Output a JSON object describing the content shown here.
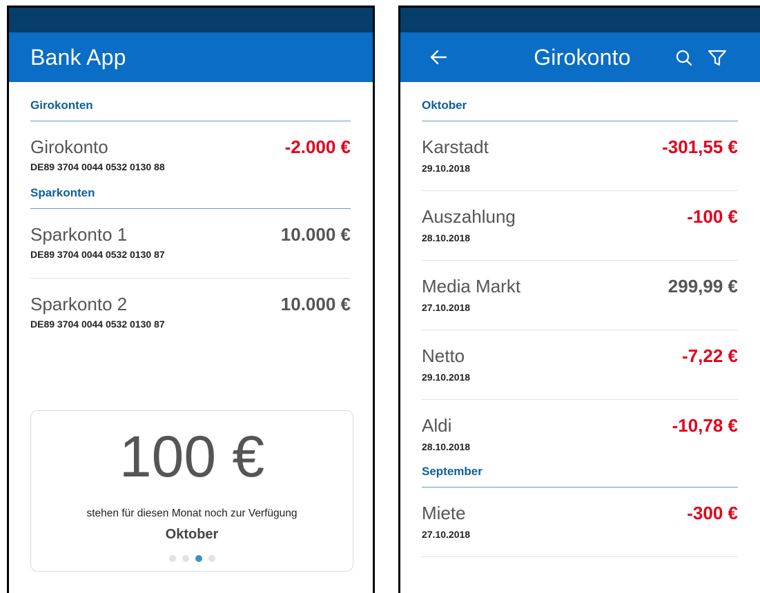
{
  "left": {
    "title": "Bank App",
    "sections": [
      {
        "heading": "Girokonten",
        "accounts": [
          {
            "name": "Girokonto",
            "iban": "DE89 3704 0044 0532 0130 88",
            "amount": "-2.000 €",
            "negative": true
          }
        ]
      },
      {
        "heading": "Sparkonten",
        "accounts": [
          {
            "name": "Sparkonto 1",
            "iban": "DE89 3704 0044 0532 0130 87",
            "amount": "10.000 €",
            "negative": false
          },
          {
            "name": "Sparkonto 2",
            "iban": "DE89 3704 0044 0532 0130 87",
            "amount": "10.000 €",
            "negative": false
          }
        ]
      }
    ],
    "budget": {
      "amount": "100 €",
      "text": "stehen für diesen Monat noch zur Verfügung",
      "month": "Oktober",
      "page_count": 4,
      "active_page": 3
    }
  },
  "right": {
    "title": "Girokonto",
    "icons": [
      "back-arrow-icon",
      "search-icon",
      "filter-icon"
    ],
    "sections": [
      {
        "heading": "Oktober",
        "transactions": [
          {
            "name": "Karstadt",
            "date": "29.10.2018",
            "amount": "-301,55 €",
            "negative": true
          },
          {
            "name": "Auszahlung",
            "date": "28.10.2018",
            "amount": "-100 €",
            "negative": true
          },
          {
            "name": "Media Markt",
            "date": "27.10.2018",
            "amount": "299,99 €",
            "negative": false
          },
          {
            "name": "Netto",
            "date": "29.10.2018",
            "amount": "-7,22 €",
            "negative": true
          },
          {
            "name": "Aldi",
            "date": "28.10.2018",
            "amount": "-10,78 €",
            "negative": true
          }
        ]
      },
      {
        "heading": "September",
        "transactions": [
          {
            "name": "Miete",
            "date": "27.10.2018",
            "amount": "-300 €",
            "negative": true
          }
        ]
      }
    ]
  },
  "colors": {
    "statusbar": "#053d6b",
    "appbar": "#0a6dc6",
    "section_heading": "#0b5f9c",
    "negative_amount": "#e3001b",
    "neutral_amount": "#555555",
    "active_dot": "#3f8fcf"
  }
}
